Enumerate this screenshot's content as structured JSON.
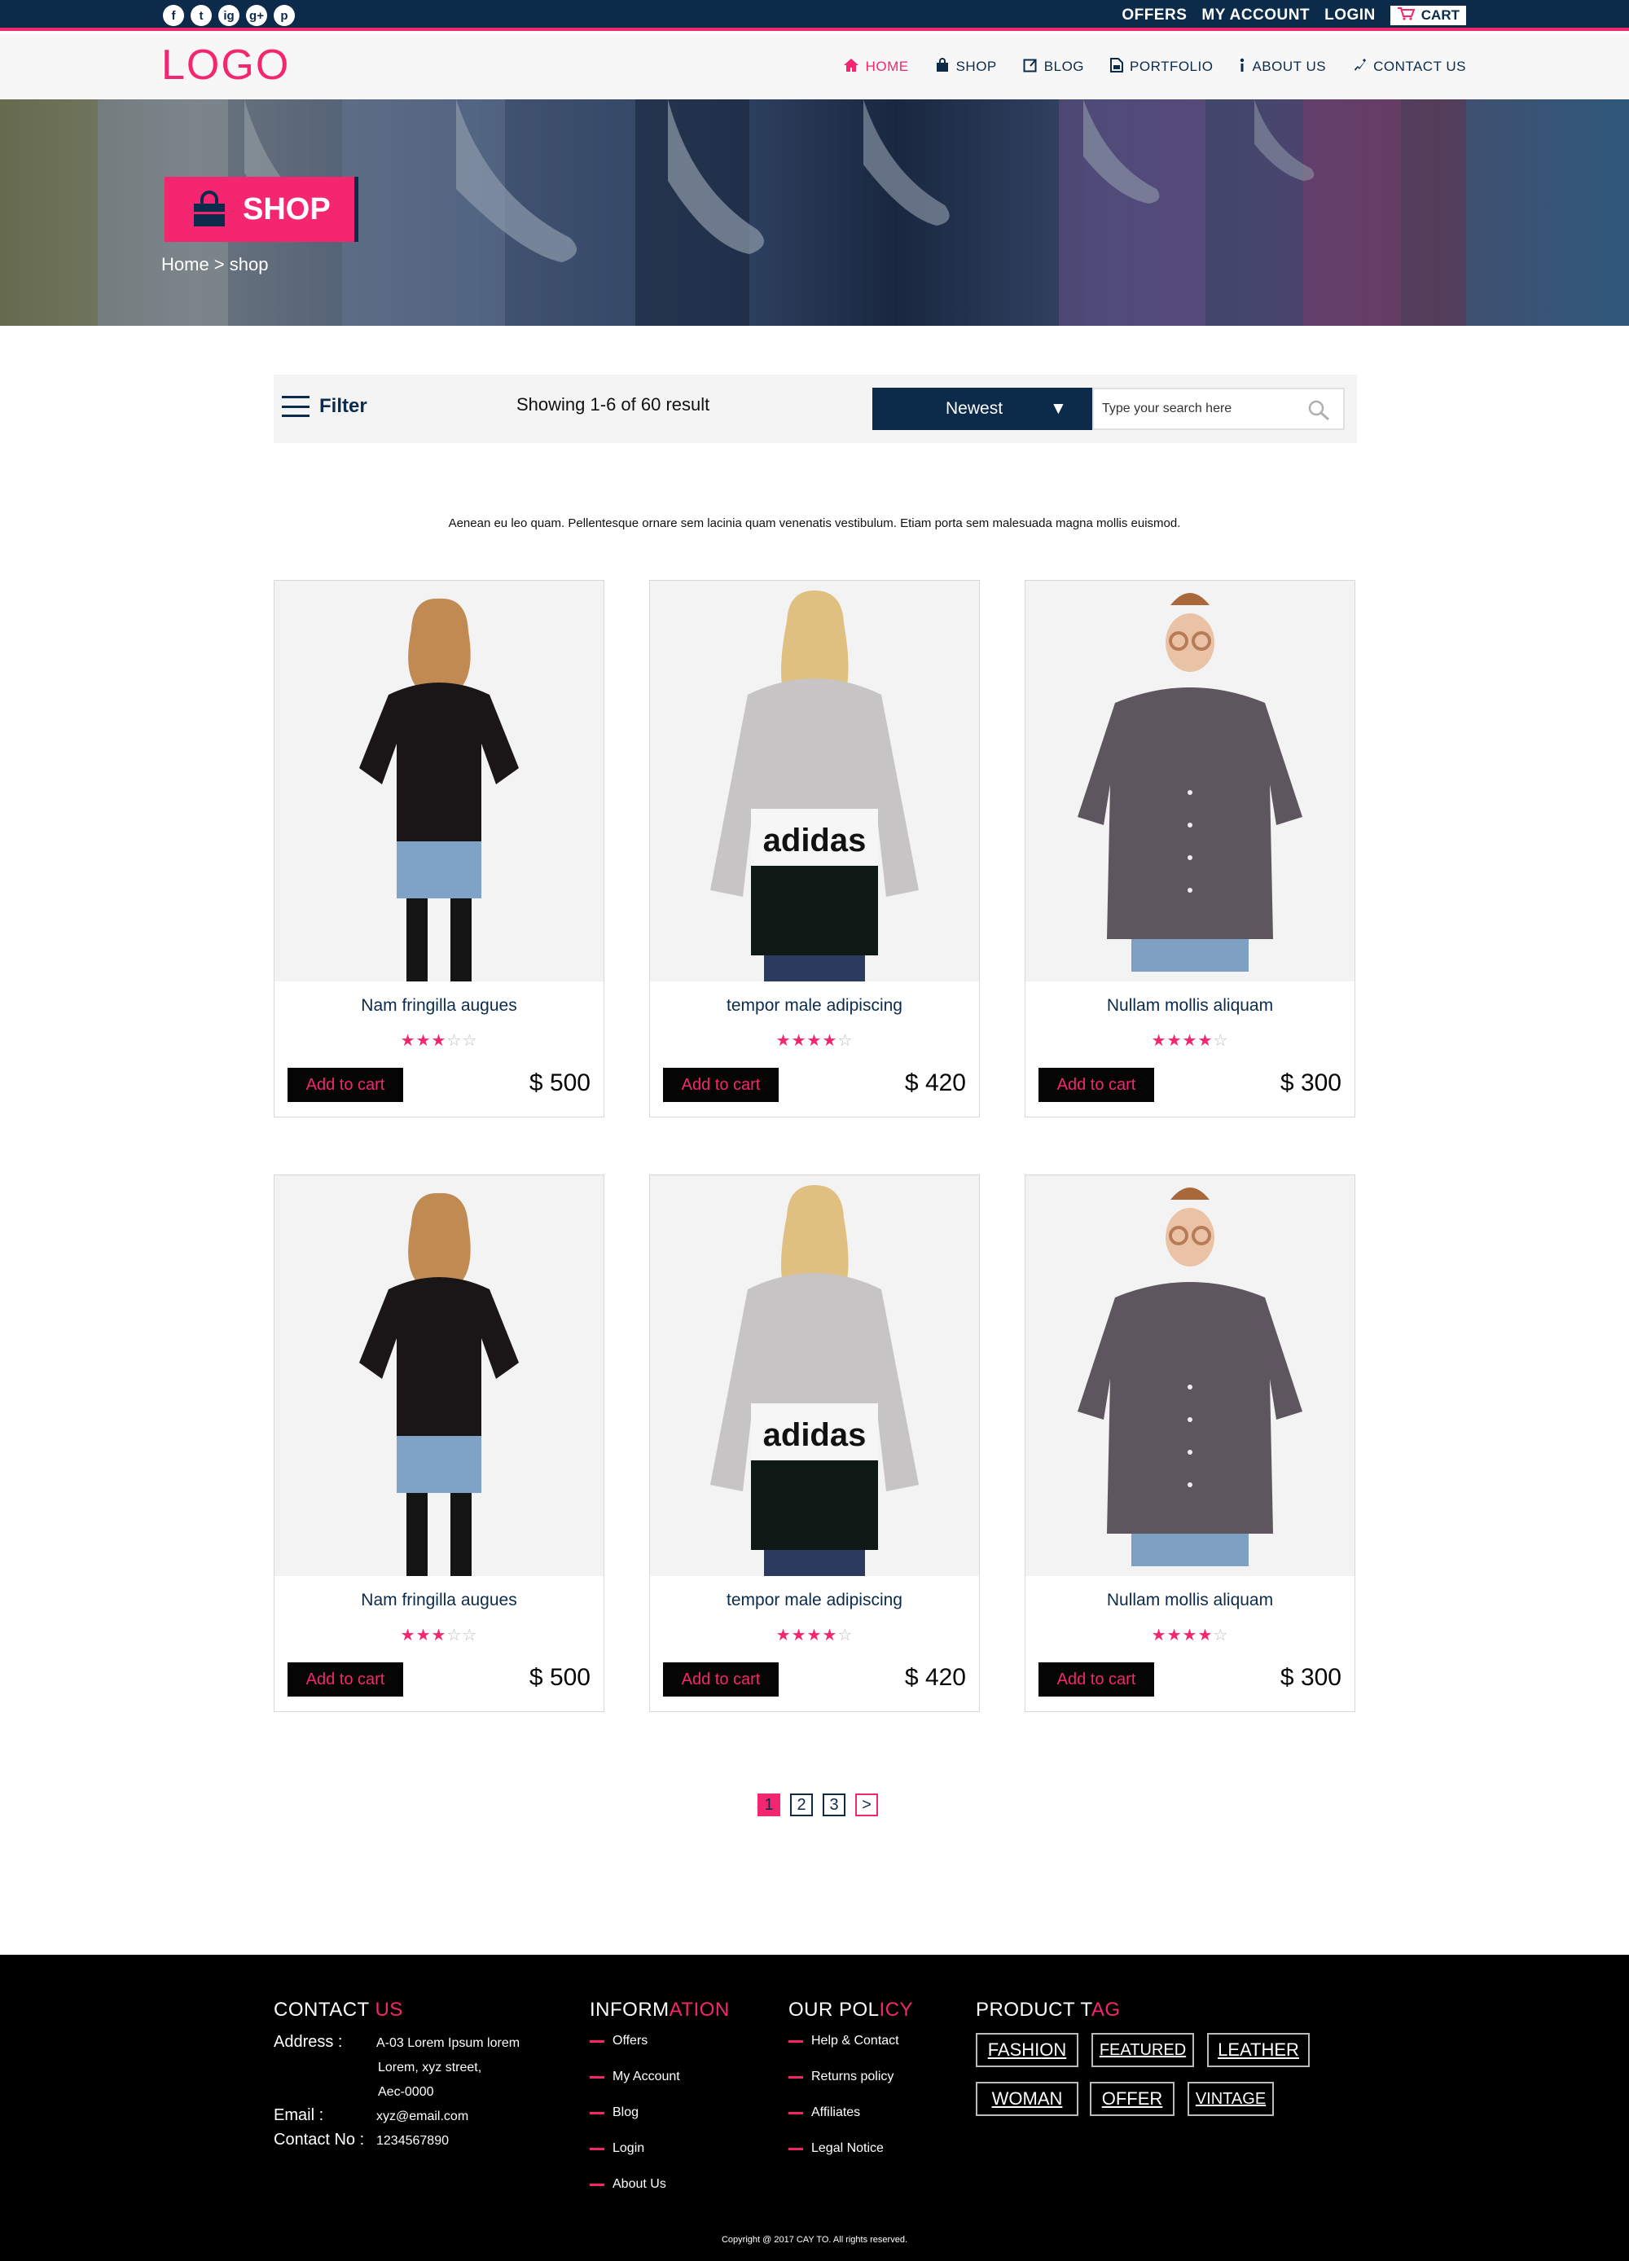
{
  "topbar": {
    "social": [
      "f",
      "t",
      "ig",
      "g+",
      "p"
    ],
    "social_icons": [
      "facebook-icon",
      "twitter-icon",
      "instagram-icon",
      "google-plus-icon",
      "pinterest-icon"
    ],
    "links": [
      "OFFERS",
      "MY ACCOUNT",
      "LOGIN"
    ],
    "cart_label": "CART"
  },
  "header": {
    "logo": "LOGO",
    "nav": [
      {
        "label": "HOME",
        "icon": "home-icon",
        "active": true
      },
      {
        "label": "SHOP",
        "icon": "bag-icon",
        "active": false
      },
      {
        "label": "BLOG",
        "icon": "blog-icon",
        "active": false
      },
      {
        "label": "PORTFOLIO",
        "icon": "portfolio-icon",
        "active": false
      },
      {
        "label": "ABOUT US",
        "icon": "info-icon",
        "active": false
      },
      {
        "label": "CONTACT US",
        "icon": "phone-icon",
        "active": false
      }
    ]
  },
  "hero": {
    "title": "SHOP",
    "breadcrumb": "Home > shop"
  },
  "toolbar": {
    "filter_label": "Filter",
    "showing_text": "Showing  1-6 of 60 result",
    "sort_value": "Newest",
    "sort_arrow": "▼",
    "search_placeholder": "Type your search here"
  },
  "description": "Aenean eu leo quam. Pellentesque ornare sem lacinia quam venenatis vestibulum. Etiam porta sem malesuada magna mollis euismod.",
  "products": [
    {
      "name": "Nam fringilla augues",
      "rating": 3,
      "max_rating": 5,
      "price": "$ 500",
      "button": "Add to cart",
      "image": "black-jacket-model"
    },
    {
      "name": "tempor male adipiscing",
      "rating": 4,
      "max_rating": 5,
      "price": "$ 420",
      "button": "Add to cart",
      "image": "adidas-sweatshirt-model",
      "image_text": "adidas"
    },
    {
      "name": "Nullam mollis aliquam",
      "rating": 4,
      "max_rating": 5,
      "price": "$ 300",
      "button": "Add to cart",
      "image": "grey-shirt-model"
    },
    {
      "name": "Nam fringilla augues",
      "rating": 3,
      "max_rating": 5,
      "price": "$ 500",
      "button": "Add to cart",
      "image": "black-jacket-model"
    },
    {
      "name": "tempor male adipiscing",
      "rating": 4,
      "max_rating": 5,
      "price": "$ 420",
      "button": "Add to cart",
      "image": "adidas-sweatshirt-model",
      "image_text": "adidas"
    },
    {
      "name": "Nullam mollis aliquam",
      "rating": 4,
      "max_rating": 5,
      "price": "$ 300",
      "button": "Add to cart",
      "image": "grey-shirt-model"
    }
  ],
  "pagination": {
    "pages": [
      "1",
      "2",
      "3"
    ],
    "current": "1",
    "next": ">"
  },
  "footer": {
    "contact": {
      "heading_a": "CONTACT ",
      "heading_b": "US",
      "address_label": "Address :",
      "address_lines": [
        "A-03 Lorem Ipsum lorem",
        "Lorem, xyz street,",
        "Aec-0000"
      ],
      "email_label": "Email :",
      "email": "xyz@email.com",
      "phone_label": "Contact No :",
      "phone": "1234567890"
    },
    "information": {
      "heading_a": "INFORM",
      "heading_b": "ATION",
      "items": [
        "Offers",
        "My Account",
        "Blog",
        "Login",
        "About Us"
      ]
    },
    "policy": {
      "heading_a": "OUR POL",
      "heading_b": "ICY",
      "items": [
        "Help & Contact",
        "Returns policy",
        "Affiliates",
        "Legal Notice"
      ]
    },
    "tags": {
      "heading_a": "PRODUCT T",
      "heading_b": "AG",
      "items": [
        "FASHION",
        "FEATURED",
        "LEATHER",
        "WOMAN",
        "OFFER",
        "VINTAGE"
      ]
    },
    "copyright": "Copyright @ 2017 CAY TO. All rights reserved."
  },
  "colors": {
    "navy": "#0c2b4b",
    "pink": "#f4266f",
    "black": "#000000"
  }
}
